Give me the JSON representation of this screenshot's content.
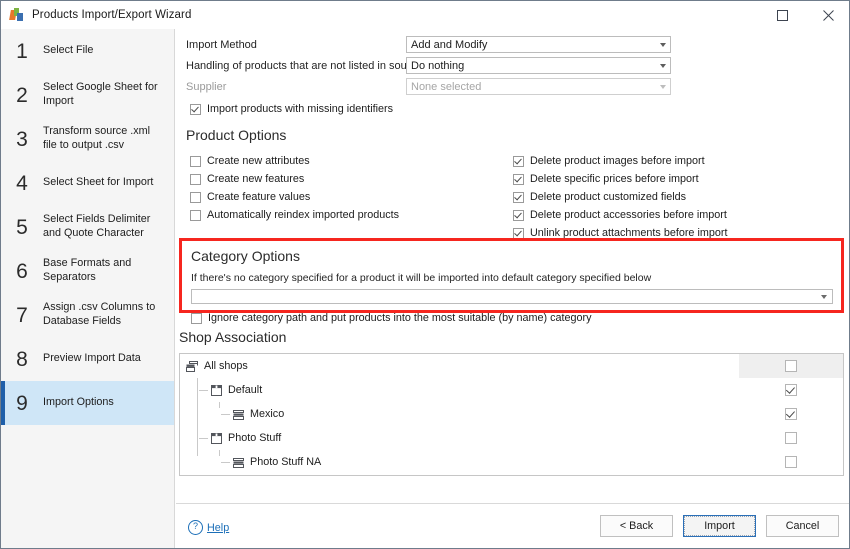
{
  "window": {
    "title": "Products Import/Export Wizard",
    "icon": "app-logo-icon",
    "maximize_label": "Maximize",
    "close_label": "Close"
  },
  "sidebar": {
    "steps": [
      {
        "num": "1",
        "label": "Select File",
        "active": false
      },
      {
        "num": "2",
        "label": "Select Google Sheet for Import",
        "active": false
      },
      {
        "num": "3",
        "label": "Transform source .xml file to output .csv",
        "active": false
      },
      {
        "num": "4",
        "label": "Select Sheet for Import",
        "active": false
      },
      {
        "num": "5",
        "label": "Select Fields Delimiter and Quote Character",
        "active": false
      },
      {
        "num": "6",
        "label": "Base Formats and Separators",
        "active": false
      },
      {
        "num": "7",
        "label": "Assign .csv Columns to Database Fields",
        "active": false
      },
      {
        "num": "8",
        "label": "Preview Import Data",
        "active": false
      },
      {
        "num": "9",
        "label": "Import Options",
        "active": true
      }
    ]
  },
  "top_fields": {
    "import_method": {
      "label": "Import Method",
      "value": "Add and Modify",
      "disabled": false
    },
    "handling": {
      "label": "Handling of products that are not listed in source file",
      "value": "Do nothing",
      "disabled": false
    },
    "supplier": {
      "label": "Supplier",
      "value": "None selected",
      "disabled": true
    },
    "missing_identifiers": {
      "label": "Import products with missing identifiers",
      "checked": true
    }
  },
  "product_options": {
    "title": "Product Options",
    "left": [
      {
        "label": "Create new attributes",
        "checked": false
      },
      {
        "label": "Create new features",
        "checked": false
      },
      {
        "label": "Create feature values",
        "checked": false
      },
      {
        "label": "Automatically reindex imported products",
        "checked": false
      }
    ],
    "right": [
      {
        "label": "Delete product images before import",
        "checked": true
      },
      {
        "label": "Delete specific prices before import",
        "checked": true
      },
      {
        "label": "Delete product customized fields",
        "checked": true
      },
      {
        "label": "Delete product accessories before import",
        "checked": true
      },
      {
        "label": "Unlink product attachments before import",
        "checked": true
      }
    ]
  },
  "category_options": {
    "title": "Category Options",
    "hint": "If there's no category specified for a product it will be imported into default category specified below",
    "dropdown_value": "",
    "ignore_path": {
      "label": "Ignore category path and put products into the most suitable (by name) category",
      "checked": false
    },
    "highlight_color": "#f6261f"
  },
  "shop_association": {
    "title": "Shop Association",
    "rows": [
      {
        "label": "All shops",
        "icon": "all-shops-icon",
        "depth": 0,
        "checked": false,
        "header": true
      },
      {
        "label": "Default",
        "icon": "shop-icon",
        "depth": 1,
        "checked": true,
        "header": false
      },
      {
        "label": "Mexico",
        "icon": "shop-group-icon",
        "depth": 2,
        "checked": true,
        "header": false
      },
      {
        "label": "Photo Stuff",
        "icon": "shop-icon",
        "depth": 1,
        "checked": false,
        "header": false
      },
      {
        "label": "Photo Stuff NA",
        "icon": "shop-group-icon",
        "depth": 2,
        "checked": false,
        "header": false
      }
    ]
  },
  "footer": {
    "help_label": "Help",
    "help_icon": "question-circle-icon",
    "back_label": "< Back",
    "import_label": "Import",
    "cancel_label": "Cancel",
    "accent_color": "#1c6fb8"
  }
}
